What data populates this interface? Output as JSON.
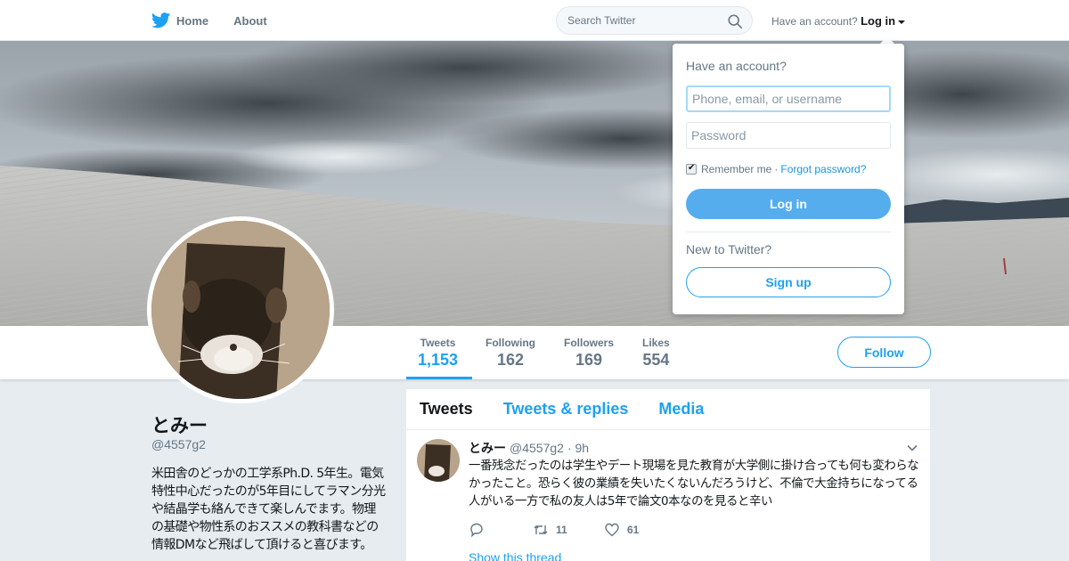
{
  "nav": {
    "home_label": "Home",
    "about_label": "About",
    "logo_icon": "twitter-bird-icon",
    "search_placeholder": "Search Twitter",
    "account_prompt": "Have an account?",
    "login_label": "Log in"
  },
  "profile": {
    "name": "とみー",
    "handle": "@4557g2",
    "bio": "米田舎のどっかの工学系Ph.D. 5年生。電気特性中心だったのが5年目にしてラマン分光や結晶学も絡んできて楽しんでます。物理の基礎や物性系のおススメの教科書などの情報DMなど飛ばして頂けると喜びます。",
    "follow_label": "Follow"
  },
  "stats": [
    {
      "label": "Tweets",
      "value": "1,153",
      "active": true
    },
    {
      "label": "Following",
      "value": "162",
      "active": false
    },
    {
      "label": "Followers",
      "value": "169",
      "active": false
    },
    {
      "label": "Likes",
      "value": "554",
      "active": false
    }
  ],
  "timeline": {
    "tabs": [
      {
        "label": "Tweets",
        "active": true
      },
      {
        "label": "Tweets & replies",
        "active": false
      },
      {
        "label": "Media",
        "active": false
      }
    ],
    "tweet": {
      "name": "とみー",
      "handle": "@4557g2",
      "time": "· 9h",
      "text": "一番残念だったのは学生やデート現場を見た教育が大学側に掛け合っても何も変わらなかったこと。恐らく彼の業績を失いたくないんだろうけど、不倫で大金持ちになってる人がいる一方で私の友人は5年で論文0本なのを見ると辛い",
      "retweets": "11",
      "likes": "61",
      "show_thread": "Show this thread"
    }
  },
  "login_dropdown": {
    "title": "Have an account?",
    "username_placeholder": "Phone, email, or username",
    "password_placeholder": "Password",
    "remember_label": "Remember me",
    "separator": "·",
    "forgot_label": "Forgot password?",
    "login_button": "Log in",
    "new_prompt": "New to Twitter?",
    "signup_button": "Sign up"
  },
  "colors": {
    "accent": "#1da1f2",
    "login_button": "#55adee",
    "page_bg": "#e6ecf0"
  }
}
